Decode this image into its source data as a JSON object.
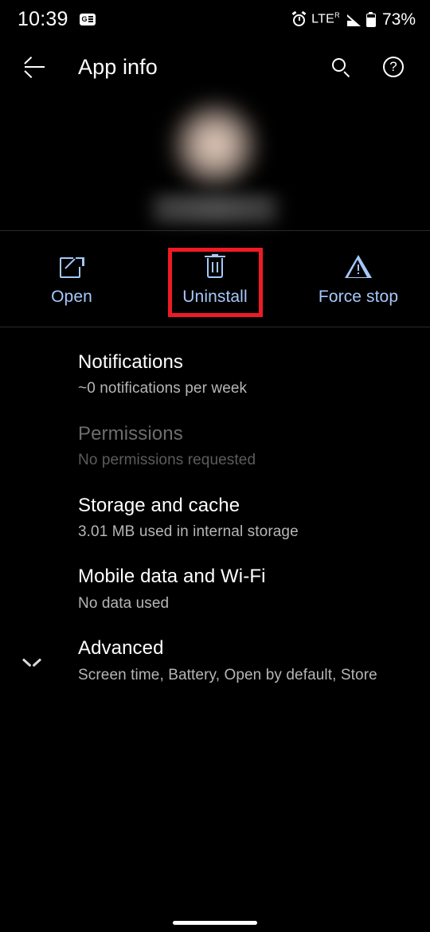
{
  "status_bar": {
    "clock": "10:39",
    "notification_icon": "google-notification-badge-icon",
    "alarm_icon": "alarm-clock-icon",
    "network_type": "LTE",
    "network_roaming_superscript": "R",
    "signal_icon": "cellular-signal-icon",
    "battery_icon": "battery-icon",
    "battery_percent": "73%"
  },
  "app_bar": {
    "back_icon": "arrow-back-icon",
    "title": "App info",
    "search_icon": "search-icon",
    "help_label": "?",
    "help_icon": "help-circle-icon"
  },
  "app_header": {
    "app_icon": "app-icon-blurred",
    "app_name": "",
    "redacted": "blurred"
  },
  "actions": [
    {
      "label": "Open",
      "icon": "open-in-new-icon",
      "highlighted": false
    },
    {
      "label": "Uninstall",
      "icon": "trash-icon",
      "highlighted": true
    },
    {
      "label": "Force stop",
      "icon": "warning-triangle-icon",
      "highlighted": false
    }
  ],
  "highlight": {
    "target": "Uninstall",
    "color": "#ee1b24"
  },
  "settings": [
    {
      "title": "Notifications",
      "subtitle": "~0 notifications per week",
      "disabled": false
    },
    {
      "title": "Permissions",
      "subtitle": "No permissions requested",
      "disabled": true
    },
    {
      "title": "Storage and cache",
      "subtitle": "3.01 MB used in internal storage",
      "disabled": false
    },
    {
      "title": "Mobile data and Wi-Fi",
      "subtitle": "No data used",
      "disabled": false
    },
    {
      "title": "Advanced",
      "subtitle": "Screen time, Battery, Open by default, Store",
      "disabled": false,
      "icon": "chevron-down-icon"
    }
  ],
  "nav": {
    "gesture_pill": "home-gesture-pill"
  },
  "colors": {
    "background": "#000000",
    "accent_blue": "#a5c8fa",
    "primary_text": "#ffffff",
    "secondary_text": "#b6b6b6",
    "disabled_text": "#6d6d6d",
    "highlight_red": "#ee1b24"
  }
}
